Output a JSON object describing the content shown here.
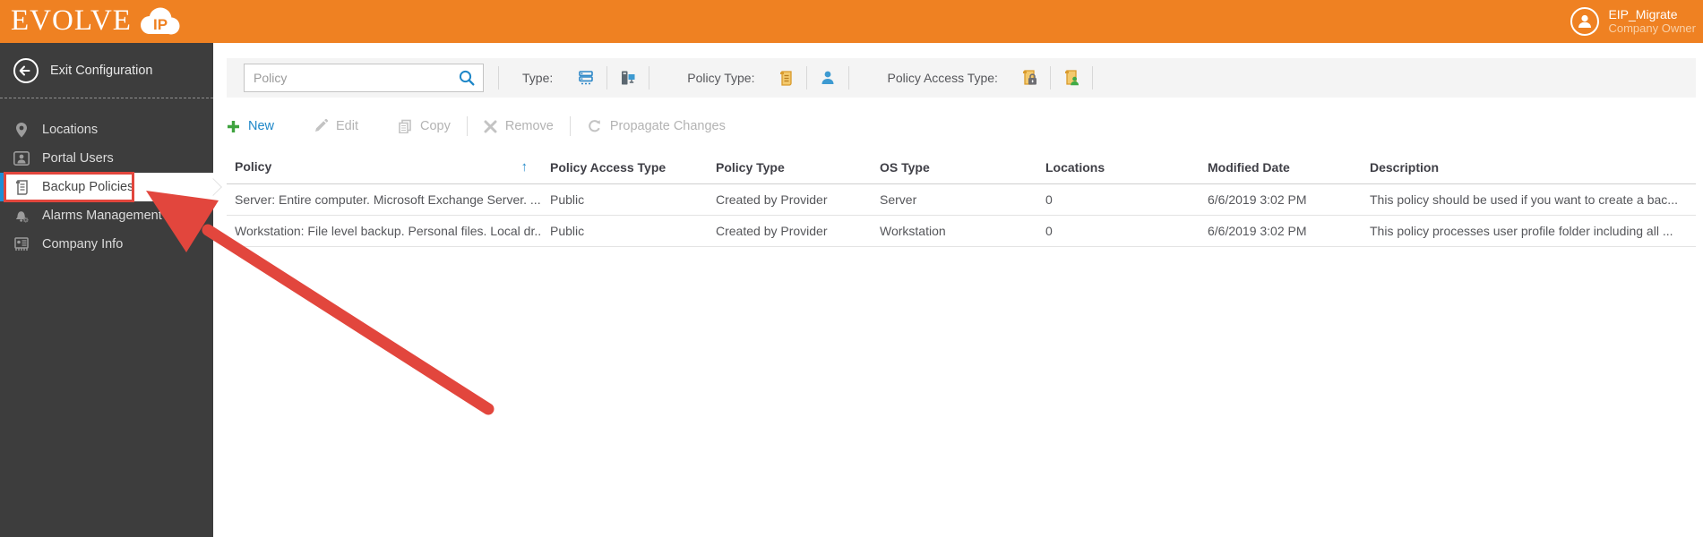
{
  "topbar": {
    "logo_text": "EVOLVE",
    "logo_badge": "IP",
    "user": {
      "name": "EIP_Migrate",
      "role": "Company Owner"
    }
  },
  "sidebar": {
    "exit_label": "Exit Configuration",
    "items": [
      {
        "label": "Locations",
        "icon": "location-pin-icon",
        "selected": false
      },
      {
        "label": "Portal Users",
        "icon": "portal-users-icon",
        "selected": false
      },
      {
        "label": "Backup Policies",
        "icon": "backup-policies-icon",
        "selected": true
      },
      {
        "label": "Alarms Management",
        "icon": "alarms-icon",
        "selected": false
      },
      {
        "label": "Company Info",
        "icon": "company-info-icon",
        "selected": false
      }
    ]
  },
  "filters": {
    "search_placeholder": "Policy",
    "search_icon": "magnifier-icon",
    "groups": [
      {
        "label": "Type:",
        "icons": [
          "server-type-icon",
          "workstation-type-icon"
        ]
      },
      {
        "label": "Policy Type:",
        "icons": [
          "provider-policy-icon",
          "user-policy-icon"
        ]
      },
      {
        "label": "Policy Access Type:",
        "icons": [
          "private-policy-icon",
          "public-policy-icon"
        ]
      }
    ]
  },
  "toolbar": {
    "new_label": "New",
    "edit_label": "Edit",
    "copy_label": "Copy",
    "remove_label": "Remove",
    "propagate_label": "Propagate Changes"
  },
  "table": {
    "columns": [
      "Policy",
      "Policy Access Type",
      "Policy Type",
      "OS Type",
      "Locations",
      "Modified Date",
      "Description"
    ],
    "sort_arrow": "↑",
    "rows": [
      {
        "policy": "Server: Entire computer. Microsoft Exchange Server. ...",
        "access": "Public",
        "type": "Created by Provider",
        "os": "Server",
        "locations": "0",
        "modified": "6/6/2019 3:02 PM",
        "description": "This policy should be used if you want to create a bac..."
      },
      {
        "policy": "Workstation: File level backup. Personal files. Local dr...",
        "access": "Public",
        "type": "Created by Provider",
        "os": "Workstation",
        "locations": "0",
        "modified": "6/6/2019 3:02 PM",
        "description": "This policy processes user profile folder including all ..."
      }
    ]
  },
  "colors": {
    "brand_orange": "#ef8122",
    "sidebar_dark": "#3d3d3d",
    "accent_blue": "#1e87c8",
    "selected_stripe_blue": "#1e8fd5",
    "annotation_red": "#e2463d",
    "new_plus_green": "#3fa33f",
    "policy_doc_yellow": "#e8a33d",
    "public_person_green": "#3faa46"
  }
}
